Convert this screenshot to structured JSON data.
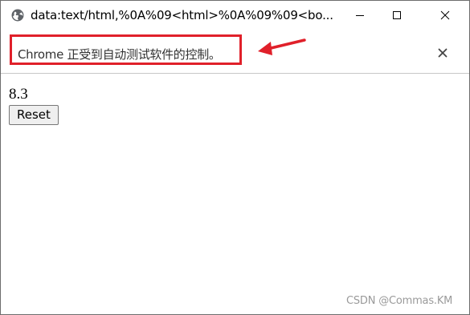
{
  "window": {
    "title": "data:text/html,%0A%09<html>%0A%09%09<bo...",
    "favicon_icon": "globe-icon",
    "controls": {
      "minimize_icon": "minimize-icon",
      "maximize_icon": "maximize-icon",
      "close_icon": "close-icon"
    }
  },
  "infobar": {
    "message": "Chrome 正受到自动测试软件的控制。",
    "close_icon": "close-icon",
    "highlight_color": "#e0202a",
    "arrow_color": "#e0202a"
  },
  "page": {
    "value": "8.3",
    "reset_label": "Reset"
  },
  "watermark": {
    "text": "CSDN @Commas.KM"
  }
}
